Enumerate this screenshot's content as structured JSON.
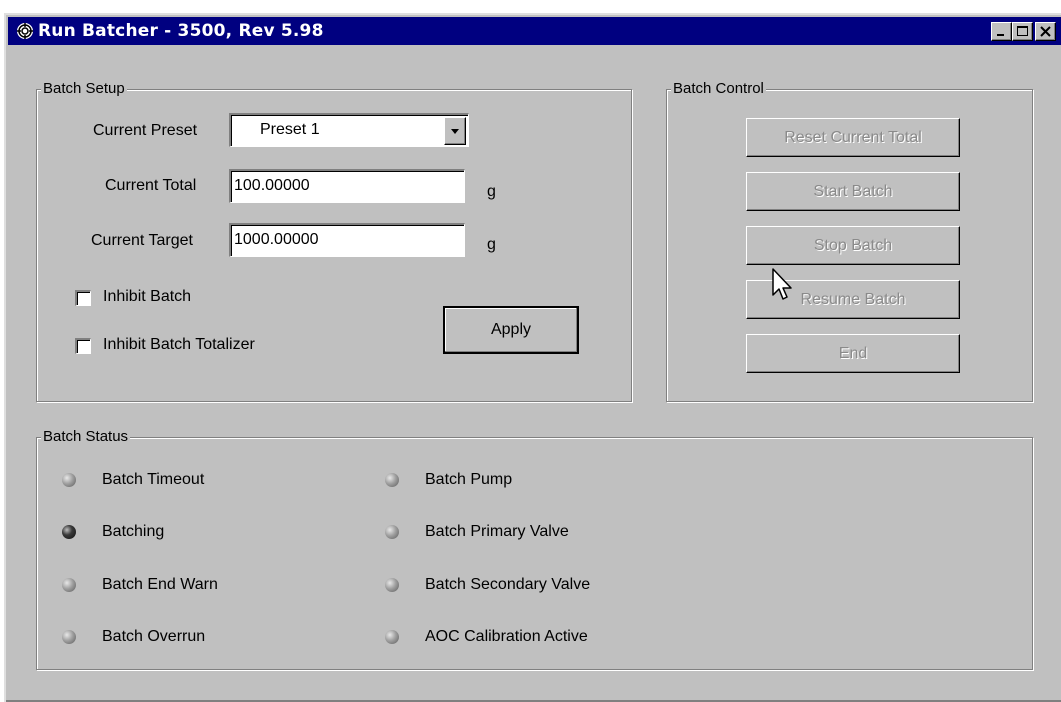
{
  "window": {
    "title": "Run Batcher -  3500, Rev 5.98",
    "controls": [
      "minimize",
      "maximize",
      "close"
    ]
  },
  "batch_setup": {
    "legend": "Batch Setup",
    "current_preset_label": "Current Preset",
    "current_preset_value": "Preset 1",
    "current_total_label": "Current Total",
    "current_total_value": "100.00000",
    "current_total_unit": "g",
    "current_target_label": "Current Target",
    "current_target_value": "1000.00000",
    "current_target_unit": "g",
    "inhibit_batch_label": "Inhibit Batch",
    "inhibit_batch_checked": false,
    "inhibit_totalizer_label": "Inhibit Batch Totalizer",
    "inhibit_totalizer_checked": false,
    "apply_label": "Apply"
  },
  "batch_control": {
    "legend": "Batch Control",
    "buttons": [
      {
        "label": "Reset Current Total",
        "enabled": false
      },
      {
        "label": "Start Batch",
        "enabled": false
      },
      {
        "label": "Stop Batch",
        "enabled": false
      },
      {
        "label": "Resume Batch",
        "enabled": false
      },
      {
        "label": "End",
        "enabled": false
      }
    ]
  },
  "batch_status": {
    "legend": "Batch Status",
    "left": [
      {
        "label": "Batch Timeout",
        "state": "off"
      },
      {
        "label": "Batching",
        "state": "on"
      },
      {
        "label": "Batch End Warn",
        "state": "off"
      },
      {
        "label": "Batch Overrun",
        "state": "off"
      }
    ],
    "right": [
      {
        "label": "Batch Pump",
        "state": "off"
      },
      {
        "label": "Batch Primary Valve",
        "state": "off"
      },
      {
        "label": "Batch Secondary Valve",
        "state": "off"
      },
      {
        "label": "AOC Calibration Active",
        "state": "off"
      }
    ]
  },
  "colors": {
    "titlebar": "#000080",
    "face": "#c0c0c0",
    "disabled_text": "#8a8a8a"
  }
}
